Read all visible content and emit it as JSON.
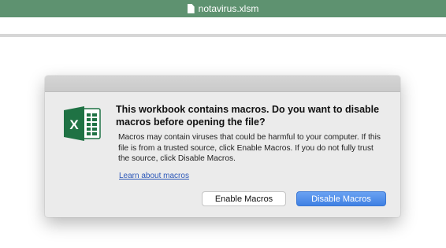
{
  "window": {
    "title": "notavirus.xlsm"
  },
  "dialog": {
    "heading": "This workbook contains macros. Do you want to disable macros before opening the file?",
    "message": "Macros may contain viruses that could be harmful to your computer.  If this file is from a trusted source, click Enable Macros. If you do not fully trust the source, click Disable Macros.",
    "link_label": "Learn about macros",
    "enable_button_label": "Enable Macros",
    "disable_button_label": "Disable Macros",
    "app_icon": "excel-icon"
  },
  "colors": {
    "titlebar": "#5e9270",
    "link": "#2b57b8",
    "primary_button": "#4a8ae8",
    "excel_green": "#1f7244"
  }
}
